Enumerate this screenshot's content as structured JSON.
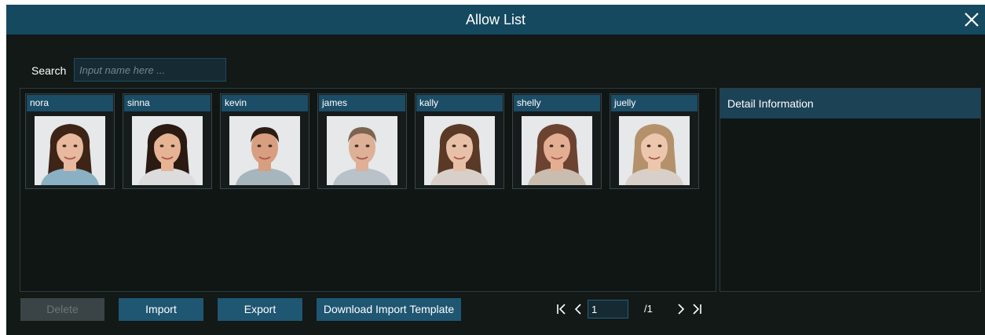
{
  "dialog": {
    "title": "Allow List"
  },
  "search": {
    "label": "Search",
    "placeholder": "Input name here ...",
    "value": ""
  },
  "faces": [
    {
      "name": "nora",
      "hair": "#3d2417",
      "skin": "#e8b99e",
      "shirt": "#8ab0c4"
    },
    {
      "name": "sinna",
      "hair": "#2a1a12",
      "skin": "#e6b394",
      "shirt": "#dcdcdc"
    },
    {
      "name": "kevin",
      "hair": "#2b1d14",
      "skin": "#d89e80",
      "shirt": "#a7b5bd"
    },
    {
      "name": "james",
      "hair": "#7d6450",
      "skin": "#ddb097",
      "shirt": "#b8c2c8"
    },
    {
      "name": "kally",
      "hair": "#5a3a26",
      "skin": "#e8c0a7",
      "shirt": "#d8d0c8"
    },
    {
      "name": "shelly",
      "hair": "#6b4330",
      "skin": "#e4ae92",
      "shirt": "#c9bdb0"
    },
    {
      "name": "juelly",
      "hair": "#b4916b",
      "skin": "#edc6ae",
      "shirt": "#d8d0c8"
    }
  ],
  "detail": {
    "header": "Detail Information"
  },
  "actions": {
    "delete_label": "Delete",
    "import_label": "Import",
    "export_label": "Export",
    "download_label": "Download Import Template"
  },
  "pagination": {
    "current_page": "1",
    "total_pages": "/1"
  },
  "icons": {
    "close": "close-icon",
    "first": "first-page-icon",
    "prev": "prev-page-icon",
    "next": "next-page-icon",
    "last": "last-page-icon"
  },
  "colors": {
    "title_bar": "#15495f",
    "background": "#121917",
    "button": "#1f5672",
    "button_disabled": "#3a4446",
    "card_header": "#1c4d66"
  }
}
